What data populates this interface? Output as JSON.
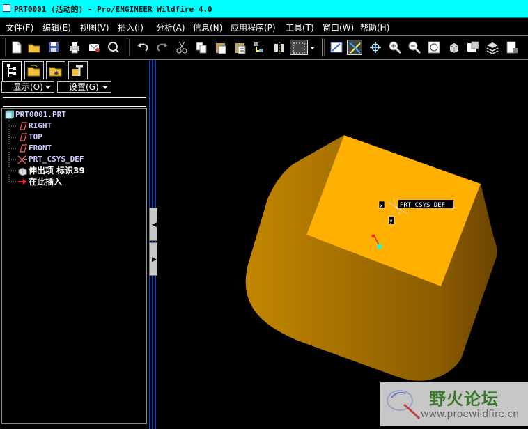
{
  "window": {
    "title": "PRT0001 (活动的) - Pro/ENGINEER Wildfire 4.0"
  },
  "menu": [
    {
      "label": "文件(F)"
    },
    {
      "label": "编辑(E)"
    },
    {
      "label": "视图(V)"
    },
    {
      "label": "插入(I)"
    },
    {
      "label": "分析(A)"
    },
    {
      "label": "信息(N)"
    },
    {
      "label": "应用程序(P)"
    },
    {
      "label": "工具(T)"
    },
    {
      "label": "窗口(W)"
    },
    {
      "label": "帮助(H)"
    }
  ],
  "toolbar": {
    "buttons": [
      {
        "icon": "new-file-icon"
      },
      {
        "icon": "open-folder-icon"
      },
      {
        "icon": "save-icon"
      },
      {
        "icon": "print-icon"
      },
      {
        "icon": "email-icon"
      },
      {
        "icon": "send-link-icon"
      },
      {
        "icon": "undo-icon"
      },
      {
        "icon": "redo-icon"
      },
      {
        "icon": "cut-icon"
      },
      {
        "icon": "copy-icon"
      },
      {
        "icon": "paste-icon"
      },
      {
        "icon": "paste-special-icon"
      },
      {
        "icon": "regenerate-icon"
      },
      {
        "icon": "mirror-icon"
      },
      {
        "icon": "select-box-icon"
      },
      {
        "icon": "repaint-icon"
      },
      {
        "icon": "spin-center-icon"
      },
      {
        "icon": "orient-mode-icon"
      },
      {
        "icon": "zoom-in-icon"
      },
      {
        "icon": "zoom-out-icon"
      },
      {
        "icon": "refit-icon"
      },
      {
        "icon": "reorient-icon"
      },
      {
        "icon": "saved-views-icon"
      },
      {
        "icon": "layers-icon"
      },
      {
        "icon": "view-manager-icon"
      }
    ]
  },
  "nav": {
    "tabs": [
      {
        "icon": "model-tree-icon"
      },
      {
        "icon": "folder-browser-icon"
      },
      {
        "icon": "favorites-icon"
      },
      {
        "icon": "connections-icon"
      }
    ],
    "display_label": "显示(O)",
    "settings_label": "设置(G)",
    "tree": [
      {
        "label": "PRT0001.PRT",
        "icon": "part-icon"
      },
      {
        "label": "RIGHT",
        "icon": "datum-plane-icon"
      },
      {
        "label": "TOP",
        "icon": "datum-plane-icon"
      },
      {
        "label": "FRONT",
        "icon": "datum-plane-icon"
      },
      {
        "label": "PRT_CSYS_DEF",
        "icon": "csys-icon"
      },
      {
        "label": "伸出项 标识39",
        "icon": "extrude-icon"
      },
      {
        "label": "在此插入",
        "icon": "insert-here-arrow-icon"
      }
    ]
  },
  "viewport": {
    "csys_label": "PRT_CSYS_DEF",
    "axis_labels": [
      "x",
      "y"
    ]
  },
  "watermark": {
    "name": "野火论坛",
    "url": "www.proewildfire.cn"
  },
  "colors": {
    "titlebar": "#00ffff",
    "background": "#000000",
    "model": "#f5a800",
    "tree_text": "#ccccff"
  }
}
